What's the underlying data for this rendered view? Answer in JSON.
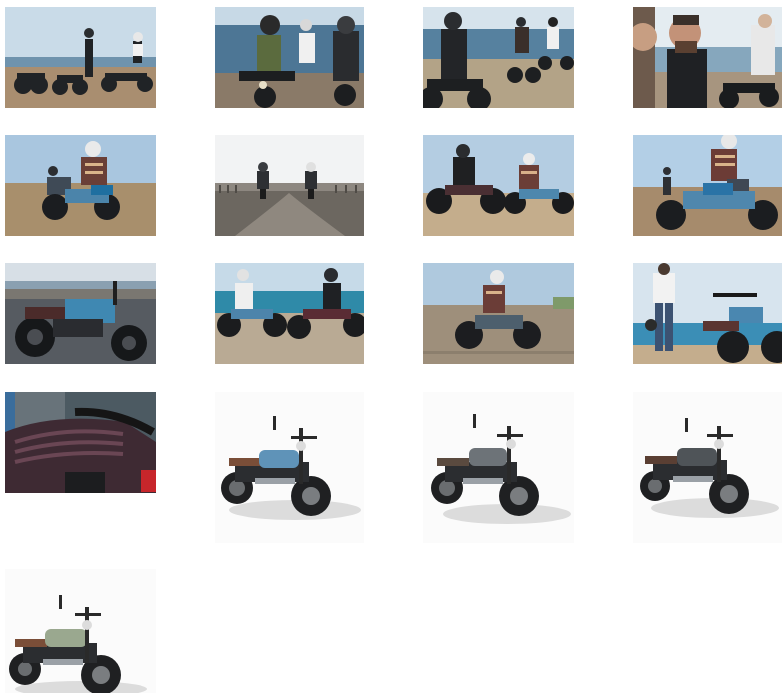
{
  "gallery": {
    "items": [
      {
        "kind": "photo",
        "scene": "three-riders-standing-by-motorcycles-seaside",
        "icon": "photo-thumbnail"
      },
      {
        "kind": "photo",
        "scene": "three-riders-seated-on-motorcycles-by-sea",
        "icon": "photo-thumbnail"
      },
      {
        "kind": "photo",
        "scene": "riders-with-motorcycles-on-coastal-rocks",
        "icon": "photo-thumbnail"
      },
      {
        "kind": "photo",
        "scene": "bearded-rider-close-up-with-companion",
        "icon": "photo-thumbnail"
      },
      {
        "kind": "photo",
        "scene": "rider-on-blue-motorcycle-dirt-field",
        "icon": "photo-thumbnail"
      },
      {
        "kind": "photo",
        "scene": "two-motorcycles-riding-toward-camera",
        "icon": "photo-thumbnail"
      },
      {
        "kind": "photo",
        "scene": "two-riders-cruising-side-by-side",
        "icon": "photo-thumbnail"
      },
      {
        "kind": "photo",
        "scene": "rider-on-blue-motorcycle-striped-sweater",
        "icon": "photo-thumbnail"
      },
      {
        "kind": "photo",
        "scene": "blue-motorcycle-parked-on-road",
        "icon": "photo-thumbnail"
      },
      {
        "kind": "photo",
        "scene": "two-riders-facing-each-other-on-bikes",
        "icon": "photo-thumbnail"
      },
      {
        "kind": "photo",
        "scene": "rider-in-motion-motion-blur",
        "icon": "photo-thumbnail"
      },
      {
        "kind": "photo",
        "scene": "rider-standing-beside-motorcycle-by-sea",
        "icon": "photo-thumbnail"
      },
      {
        "kind": "photo",
        "scene": "close-up-brown-seat-detail",
        "icon": "photo-thumbnail"
      },
      {
        "kind": "studio",
        "scene": "studio-blue-tank-motorcycle",
        "icon": "photo-thumbnail",
        "tank_color": "#5f93b8"
      },
      {
        "kind": "studio",
        "scene": "studio-grey-tank-motorcycle",
        "icon": "photo-thumbnail",
        "tank_color": "#6d7378"
      },
      {
        "kind": "studio",
        "scene": "studio-dark-grey-tank-motorcycle",
        "icon": "photo-thumbnail",
        "tank_color": "#4f5458"
      },
      {
        "kind": "studio",
        "scene": "studio-sage-green-tank-motorcycle",
        "icon": "photo-thumbnail",
        "tank_color": "#9aa88f"
      }
    ]
  },
  "colors": {
    "sky": "#b9d2e6",
    "sea": "#3f6f91",
    "ground": "#b69a7a",
    "page_bg": "#ffffff"
  }
}
